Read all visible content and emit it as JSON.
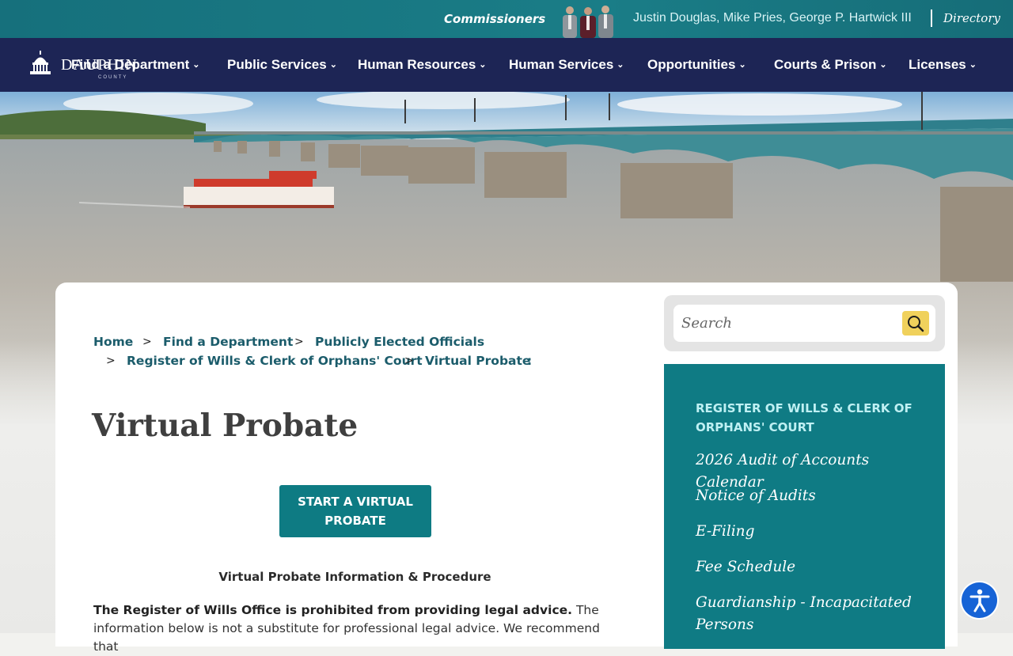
{
  "topbar": {
    "commissioners_label": "Commissioners",
    "commissioner_names": "Justin Douglas, Mike Pries, George P. Hartwick III",
    "directory_label": "Directory"
  },
  "logo": {
    "name": "DAUPHIN",
    "subtitle": "COUNTY"
  },
  "nav": {
    "items": [
      {
        "label": "Find a Department"
      },
      {
        "label": "Public Services"
      },
      {
        "label": "Human Resources"
      },
      {
        "label": "Human Services"
      },
      {
        "label": "Opportunities"
      },
      {
        "label": "Courts & Prison"
      },
      {
        "label": "Licenses"
      }
    ]
  },
  "breadcrumb": {
    "items": [
      {
        "label": "Home"
      },
      {
        "label": "Find a Department"
      },
      {
        "label": "Publicly Elected Officials"
      },
      {
        "label": "Register of Wills & Clerk of Orphans' Court"
      },
      {
        "label": "Virtual Probate"
      }
    ],
    "separator": ">",
    "trailing": ":"
  },
  "page": {
    "title": "Virtual Probate",
    "cta_label": "START A VIRTUAL PROBATE",
    "subheading": "Virtual Probate Information & Procedure",
    "body_bold": "The Register of Wills Office is prohibited from providing legal advice.",
    "body_rest": " The information below is not a substitute for professional legal advice. We recommend that"
  },
  "search": {
    "placeholder": "Search",
    "value": ""
  },
  "sidebar": {
    "heading": "REGISTER OF WILLS & CLERK OF ORPHANS' COURT",
    "links": [
      {
        "label": "2026 Audit of Accounts Calendar"
      },
      {
        "label": "Notice of Audits"
      },
      {
        "label": "E-Filing"
      },
      {
        "label": "Fee Schedule"
      },
      {
        "label": "Guardianship - Incapacitated Persons"
      }
    ]
  },
  "colors": {
    "topbar": "#1a7d87",
    "nav": "#1d2555",
    "accent_teal": "#0f7b84",
    "breadcrumb": "#1b5c6b",
    "search_button": "#f0d15c",
    "accessibility": "#1663d6"
  },
  "icons": {
    "search": "search-icon",
    "chevron": "chevron-down-icon",
    "accessibility": "accessibility-icon",
    "logo": "capitol-dome-icon"
  }
}
